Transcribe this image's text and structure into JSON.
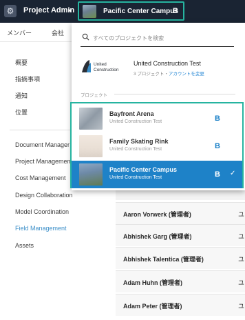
{
  "topbar": {
    "app_title": "Project Admin",
    "current_project": "Pacific Center Campus",
    "current_project_badge": "B"
  },
  "subtabs": [
    "メンバー",
    "会社"
  ],
  "sidebar": {
    "items_jp": [
      "概要",
      "指摘事項",
      "通知",
      "位置"
    ],
    "modules": [
      {
        "label": "Document Manager",
        "active": false
      },
      {
        "label": "Project Management",
        "active": false
      },
      {
        "label": "Cost Management",
        "active": false
      },
      {
        "label": "Design Collaboration",
        "active": false
      },
      {
        "label": "Model Coordination",
        "active": false
      },
      {
        "label": "Field Management",
        "active": true
      },
      {
        "label": "Assets",
        "active": false
      }
    ]
  },
  "members": [
    {
      "name": "Aaron Vorwerk (管理者)",
      "tail": "ユ"
    },
    {
      "name": "Abhishek Garg (管理者)",
      "tail": "ユ"
    },
    {
      "name": "Abhishek Talentica (管理者)",
      "tail": "ユ"
    },
    {
      "name": "Adam Huhn (管理者)",
      "tail": "ユ"
    },
    {
      "name": "Adam Peter (管理者)",
      "tail": "ユ"
    }
  ],
  "dropdown": {
    "search_placeholder": "すべてのプロジェクトを検索",
    "account": {
      "logo_line1": "United",
      "logo_line2": "Construction",
      "name": "United Construction Test",
      "meta": "3 プロジェクト・",
      "link": "アカウントを変更"
    },
    "section_label": "プロジェクト",
    "projects": [
      {
        "name": "Bayfront Arena",
        "account": "United Construction Test",
        "badge": "B",
        "selected": false
      },
      {
        "name": "Family Skating Rink",
        "account": "United Construction Test",
        "badge": "B",
        "selected": false
      },
      {
        "name": "Pacific Center Campus",
        "account": "United Construction Test",
        "badge": "B",
        "selected": true
      }
    ]
  },
  "colors": {
    "topbar": "#1a2433",
    "highlight_outline": "#26b4a0",
    "selected": "#1e82c8",
    "link": "#2b8ad6"
  }
}
